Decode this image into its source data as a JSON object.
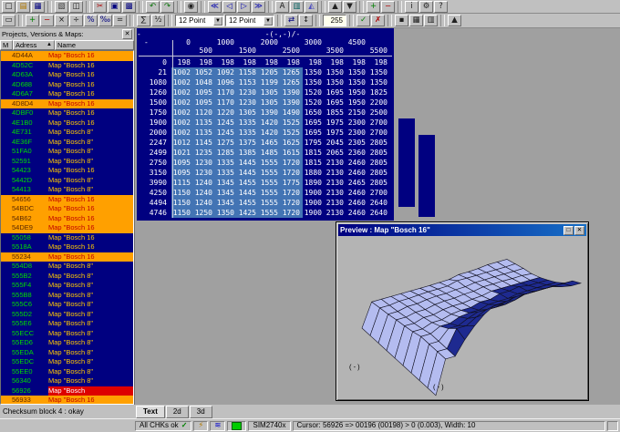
{
  "toolbar": {
    "row1": [
      {
        "name": "new",
        "glyph": "□"
      },
      {
        "name": "open",
        "glyph": "▤",
        "color": "#b07800"
      },
      {
        "name": "save",
        "glyph": "▦",
        "color": "#000080"
      },
      {
        "type": "sep"
      },
      {
        "name": "print",
        "glyph": "▧",
        "color": "#404040"
      },
      {
        "name": "print-preview",
        "glyph": "◫"
      },
      {
        "type": "sep"
      },
      {
        "name": "cut",
        "glyph": "✂",
        "color": "#b00000"
      },
      {
        "name": "copy",
        "glyph": "▣",
        "color": "#000080"
      },
      {
        "name": "paste",
        "glyph": "▩",
        "color": "#000080"
      },
      {
        "type": "sep"
      },
      {
        "name": "undo",
        "glyph": "↶",
        "color": "#007000"
      },
      {
        "name": "redo",
        "glyph": "↷",
        "color": "#007000"
      },
      {
        "type": "sep"
      },
      {
        "name": "find",
        "glyph": "◉"
      },
      {
        "type": "sep"
      },
      {
        "name": "first-map",
        "glyph": "≪",
        "color": "#0000b0"
      },
      {
        "name": "previous-map",
        "glyph": "◁",
        "color": "#0000b0"
      },
      {
        "name": "next-map",
        "glyph": "▷",
        "color": "#0000b0"
      },
      {
        "name": "last-map",
        "glyph": "≫",
        "color": "#0000b0"
      },
      {
        "type": "sep"
      },
      {
        "name": "text-view",
        "glyph": "A"
      },
      {
        "name": "view-2d",
        "glyph": "▥",
        "color": "#006060"
      },
      {
        "name": "view-3d",
        "glyph": "◭",
        "color": "#5050c0"
      },
      {
        "type": "sep"
      },
      {
        "name": "scroll-up",
        "glyph": "▲"
      },
      {
        "name": "scroll-down",
        "glyph": "▼"
      },
      {
        "type": "sep"
      },
      {
        "name": "add-map",
        "glyph": "+",
        "color": "#008000"
      },
      {
        "name": "remove-map",
        "glyph": "−",
        "color": "#b00000"
      },
      {
        "type": "sep"
      },
      {
        "name": "info",
        "glyph": "i"
      },
      {
        "name": "settings",
        "glyph": "⚙"
      },
      {
        "name": "help",
        "glyph": "?"
      }
    ],
    "row2": [
      {
        "name": "select",
        "glyph": "▭"
      },
      {
        "type": "sep"
      },
      {
        "name": "op-plus",
        "glyph": "+",
        "color": "#008000"
      },
      {
        "name": "op-minus",
        "glyph": "−",
        "color": "#b00000"
      },
      {
        "name": "op-multiply",
        "glyph": "×"
      },
      {
        "name": "op-divide",
        "glyph": "÷"
      },
      {
        "name": "op-percent",
        "glyph": "%",
        "color": "#000080"
      },
      {
        "name": "op-permille",
        "glyph": "‰",
        "color": "#000080"
      },
      {
        "name": "op-equal",
        "glyph": "="
      },
      {
        "type": "sep"
      },
      {
        "name": "sum",
        "glyph": "∑"
      },
      {
        "name": "half",
        "glyph": "½"
      },
      {
        "type": "sep"
      },
      {
        "type": "combo",
        "name": "point-size-1",
        "value": "12 Point"
      },
      {
        "type": "combo",
        "name": "point-size-2",
        "value": "12 Point"
      },
      {
        "type": "sep"
      },
      {
        "name": "swap",
        "glyph": "⇄",
        "color": "#000080"
      },
      {
        "name": "resize",
        "glyph": "↕"
      },
      {
        "type": "sep"
      },
      {
        "type": "field",
        "name": "display-value",
        "value": "255"
      },
      {
        "type": "sep"
      },
      {
        "name": "apply",
        "glyph": "✓",
        "color": "#008000"
      },
      {
        "name": "cancel",
        "glyph": "✗",
        "color": "#b00000"
      },
      {
        "type": "sep"
      },
      {
        "name": "lock",
        "glyph": "▪"
      },
      {
        "name": "grid",
        "glyph": "▦"
      },
      {
        "name": "book",
        "glyph": "▥"
      },
      {
        "type": "sep"
      },
      {
        "name": "up",
        "glyph": "▲"
      }
    ]
  },
  "sidebar": {
    "title": "Projects, Versions & Maps:",
    "close_icon": "✕",
    "columns": [
      "M",
      "Adress",
      "Name"
    ],
    "sort_icon": "▲",
    "rows": [
      {
        "addr": "4D44A",
        "name": "Map \"Bosch 16",
        "state": "hl"
      },
      {
        "addr": "4D52C",
        "name": "Map \"Bosch 16"
      },
      {
        "addr": "4D63A",
        "name": "Map \"Bosch 16"
      },
      {
        "addr": "4D688",
        "name": "Map \"Bosch 16"
      },
      {
        "addr": "4D6A7",
        "name": "Map \"Bosch 16"
      },
      {
        "addr": "4D8D4",
        "name": "Map \"Bosch 16",
        "state": "hl"
      },
      {
        "addr": "4DBF0",
        "name": "Map \"Bosch 16"
      },
      {
        "addr": "4E1B0",
        "name": "Map \"Bosch 16"
      },
      {
        "addr": "4E731",
        "name": "Map \"Bosch 8\""
      },
      {
        "addr": "4E36F",
        "name": "Map \"Bosch 8\""
      },
      {
        "addr": "51FA0",
        "name": "Map \"Bosch 8\""
      },
      {
        "addr": "52591",
        "name": "Map \"Bosch 8\""
      },
      {
        "addr": "54423",
        "name": "Map \"Bosch 16"
      },
      {
        "addr": "5442D",
        "name": "Map \"Bosch 8\""
      },
      {
        "addr": "54413",
        "name": "Map \"Bosch 8\""
      },
      {
        "addr": "54656",
        "name": "Map \"Bosch 16",
        "state": "hl"
      },
      {
        "addr": "54BDC",
        "name": "Map \"Bosch 16",
        "state": "hl"
      },
      {
        "addr": "54B62",
        "name": "Map \"Bosch 16",
        "state": "hl"
      },
      {
        "addr": "54DE9",
        "name": "Map \"Bosch 16",
        "state": "hl"
      },
      {
        "addr": "55058",
        "name": "Map \"Bosch 16"
      },
      {
        "addr": "5518A",
        "name": "Map \"Bosch 16"
      },
      {
        "addr": "55234",
        "name": "Map \"Bosch 16",
        "state": "hl"
      },
      {
        "addr": "554D8",
        "name": "Map \"Bosch 8\""
      },
      {
        "addr": "555B2",
        "name": "Map \"Bosch 8\""
      },
      {
        "addr": "555F4",
        "name": "Map \"Bosch 8\""
      },
      {
        "addr": "555B8",
        "name": "Map \"Bosch 8\""
      },
      {
        "addr": "555C6",
        "name": "Map \"Bosch 8\""
      },
      {
        "addr": "555D2",
        "name": "Map \"Bosch 8\""
      },
      {
        "addr": "555E6",
        "name": "Map \"Bosch 8\""
      },
      {
        "addr": "55ECC",
        "name": "Map \"Bosch 8\""
      },
      {
        "addr": "55ED6",
        "name": "Map \"Bosch 8\""
      },
      {
        "addr": "55EDA",
        "name": "Map \"Bosch 8\""
      },
      {
        "addr": "55EDC",
        "name": "Map \"Bosch 8\""
      },
      {
        "addr": "55EE0",
        "name": "Map \"Bosch 8\""
      },
      {
        "addr": "56340",
        "name": "Map \"Bosch 8\""
      },
      {
        "addr": "56926",
        "name": "Map \"Bosch",
        "state": "current"
      },
      {
        "addr": "56933",
        "name": "Map \"Bosch 16",
        "state": "hl"
      }
    ]
  },
  "map_table": {
    "corner": "-",
    "selection": {
      "row_start": 1,
      "row_end": 15,
      "col_start": 0,
      "col_end": 5
    }
  },
  "chart_data": {
    "type": "surface",
    "title": "-(-,-)/-",
    "xlabel": "",
    "ylabel": "",
    "x": [
      0,
      500,
      1000,
      1500,
      2000,
      2500,
      3000,
      3500,
      4500,
      5500
    ],
    "y": [
      0,
      21,
      1080,
      1260,
      1500,
      1750,
      1900,
      2000,
      2247,
      2499,
      2750,
      3150,
      3990,
      4250,
      4494,
      4746
    ],
    "values": [
      [
        198,
        198,
        198,
        198,
        198,
        198,
        198,
        198,
        198,
        198
      ],
      [
        1002,
        1052,
        1092,
        1158,
        1205,
        1265,
        1350,
        1350,
        1350,
        1350
      ],
      [
        1002,
        1048,
        1096,
        1153,
        1199,
        1265,
        1350,
        1350,
        1350,
        1350
      ],
      [
        1002,
        1095,
        1170,
        1230,
        1305,
        1390,
        1520,
        1695,
        1950,
        1825
      ],
      [
        1002,
        1095,
        1170,
        1230,
        1305,
        1390,
        1520,
        1695,
        1950,
        2200
      ],
      [
        1002,
        1120,
        1220,
        1305,
        1390,
        1490,
        1650,
        1855,
        2150,
        2500
      ],
      [
        1002,
        1135,
        1245,
        1335,
        1420,
        1525,
        1695,
        1975,
        2300,
        2700
      ],
      [
        1002,
        1135,
        1245,
        1335,
        1420,
        1525,
        1695,
        1975,
        2300,
        2700
      ],
      [
        1012,
        1145,
        1275,
        1375,
        1465,
        1625,
        1795,
        2045,
        2305,
        2805
      ],
      [
        1021,
        1235,
        1285,
        1385,
        1485,
        1615,
        1815,
        2065,
        2360,
        2805
      ],
      [
        1095,
        1230,
        1335,
        1445,
        1555,
        1720,
        1815,
        2130,
        2460,
        2805
      ],
      [
        1095,
        1230,
        1335,
        1445,
        1555,
        1720,
        1880,
        2130,
        2460,
        2805
      ],
      [
        1115,
        1240,
        1345,
        1455,
        1555,
        1775,
        1890,
        2130,
        2465,
        2805
      ],
      [
        1150,
        1240,
        1345,
        1445,
        1555,
        1720,
        1900,
        2130,
        2460,
        2700
      ],
      [
        1150,
        1240,
        1345,
        1455,
        1555,
        1720,
        1900,
        2130,
        2460,
        2640
      ],
      [
        1150,
        1250,
        1350,
        1425,
        1555,
        1720,
        1900,
        2130,
        2460,
        2640
      ]
    ],
    "colors": {
      "low": "#b4bcf0",
      "high": "#1e2a90",
      "threshold": 1600
    }
  },
  "preview": {
    "title": "Preview : Map \"Bosch 16\"",
    "btn_min": "□",
    "btn_close": "✕",
    "axis1": "( - )",
    "axis2": "( - )"
  },
  "tabs": [
    {
      "label": "Text",
      "active": true
    },
    {
      "label": "2d",
      "active": false
    },
    {
      "label": "3d",
      "active": false
    }
  ],
  "bottom": {
    "checksum": "Checksum block 4 : okay"
  },
  "status": {
    "chk": "All CHKs ok",
    "check_icon": "✓",
    "bolt_icon": "⚡",
    "wave_icon": "≋",
    "sim": "SIM2740x",
    "cursor": "Cursor: 56926 => 00196 (00198) > 0 (0.003), Width: 10"
  }
}
